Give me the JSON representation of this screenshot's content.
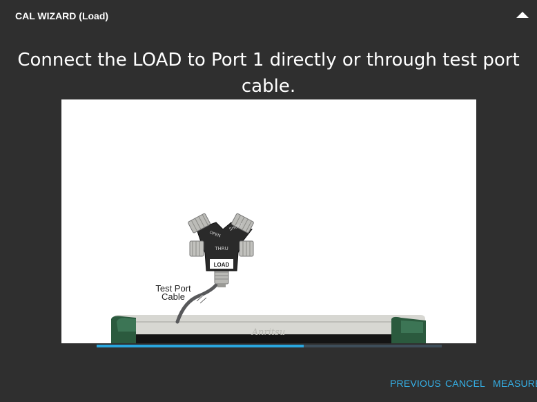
{
  "header": {
    "title": "CAL WIZARD (Load)",
    "collapse_icon": "triangle-up-icon"
  },
  "instruction": "Connect the LOAD to Port 1 directly or through test port cable.",
  "illustration": {
    "labels": {
      "open": "OPEN",
      "short": "SHORT",
      "thru": "THRU",
      "load": "LOAD",
      "cable_line1": "Test Port",
      "cable_line2": "Cable",
      "brand": "Anritsu"
    }
  },
  "progress": {
    "fraction": 0.6
  },
  "footer": {
    "previous_label": "PREVIOUS",
    "cancel_label": "CANCEL",
    "measure_label": "MEASURE"
  },
  "colors": {
    "background": "#2f2f2f",
    "accent": "#35b1e8",
    "progress_track": "#3d4d59",
    "instrument_green": "#2b5a3e"
  }
}
